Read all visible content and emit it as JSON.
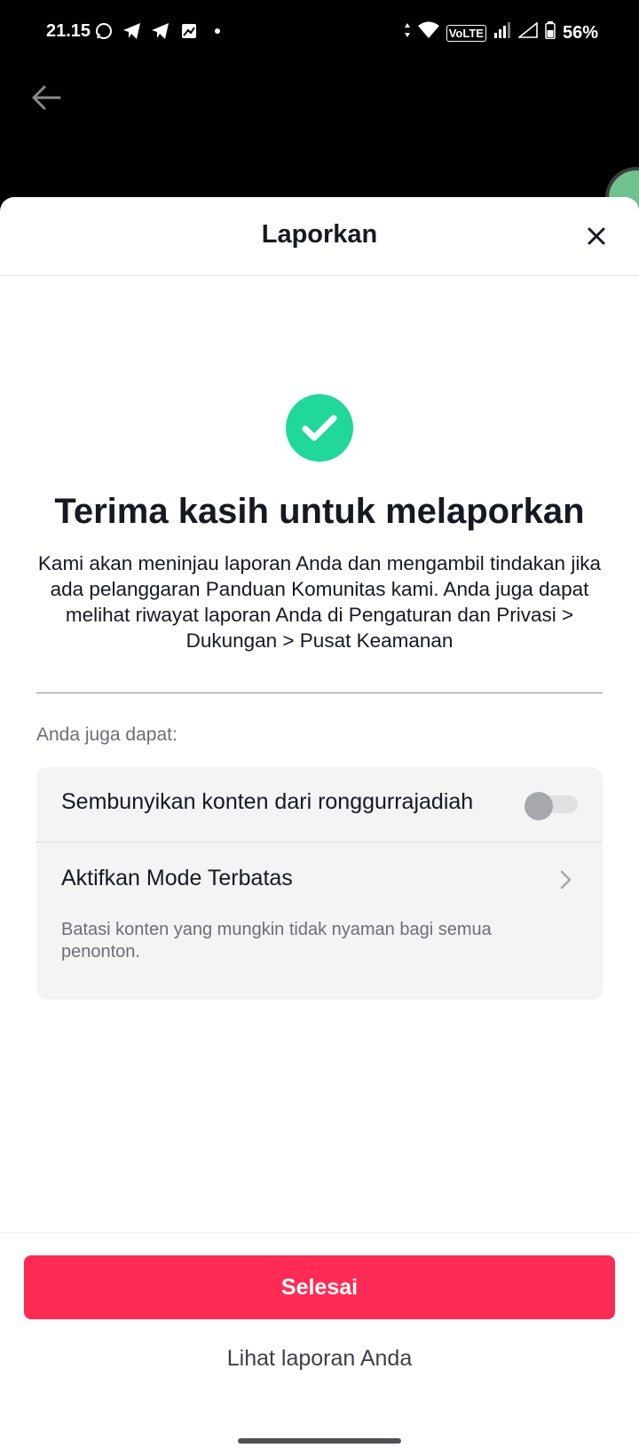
{
  "status_bar": {
    "time": "21.15",
    "network_badge": "VoLTE",
    "battery_percent": "56%",
    "icons": [
      "whatsapp-icon",
      "telegram-icon",
      "telegram-icon",
      "gallery-icon",
      "dot-icon",
      "data-arrows-icon",
      "wifi-icon",
      "signal-icon",
      "signal-empty-icon",
      "battery-icon"
    ]
  },
  "sheet": {
    "title": "Laporkan",
    "heading": "Terima kasih untuk melaporkan",
    "description": "Kami akan meninjau laporan Anda dan mengambil tindakan jika ada pelanggaran Panduan Komunitas kami. Anda juga dapat melihat riwayat laporan Anda di Pengaturan dan Privasi > Dukungan > Pusat Keamanan",
    "options_label": "Anda juga dapat:",
    "options": {
      "hide_content": {
        "label": "Sembunyikan konten dari ronggurrajadiah",
        "toggle_on": false
      },
      "restricted_mode": {
        "title": "Aktifkan Mode Terbatas",
        "description": "Batasi konten yang mungkin tidak nyaman bagi semua penonton."
      }
    },
    "done_button": "Selesai",
    "view_reports_link": "Lihat laporan Anda"
  },
  "colors": {
    "accent": "#fe2c55",
    "success": "#1fd89a",
    "card_bg": "#f4f4f5"
  }
}
